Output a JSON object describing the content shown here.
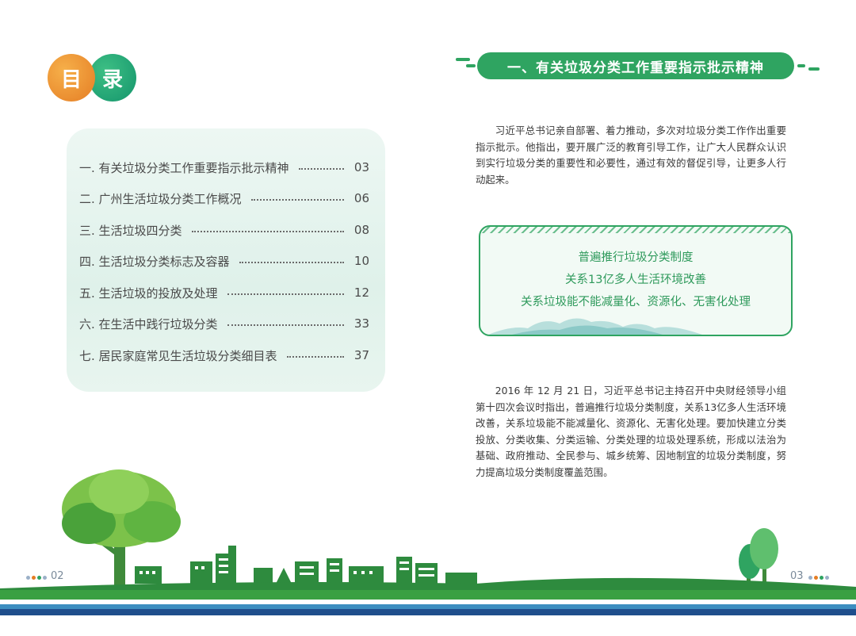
{
  "left_page": {
    "title_chars": [
      "目",
      "录"
    ],
    "toc": [
      {
        "label": "一. 有关垃圾分类工作重要指示批示精神",
        "page": "03"
      },
      {
        "label": "二. 广州生活垃圾分类工作概况",
        "page": "06"
      },
      {
        "label": "三. 生活垃圾四分类",
        "page": "08"
      },
      {
        "label": "四. 生活垃圾分类标志及容器",
        "page": "10"
      },
      {
        "label": "五. 生活垃圾的投放及处理",
        "page": "12"
      },
      {
        "label": "六. 在生活中践行垃圾分类",
        "page": "33"
      },
      {
        "label": "七. 居民家庭常见生活垃圾分类细目表",
        "page": "37"
      }
    ],
    "page_number": "02"
  },
  "right_page": {
    "section_title": "一、有关垃圾分类工作重要指示批示精神",
    "paragraph1": "习近平总书记亲自部署、着力推动，多次对垃圾分类工作作出重要指示批示。他指出，要开展广泛的教育引导工作，让广大人民群众认识到实行垃圾分类的重要性和必要性，通过有效的督促引导，让更多人行动起来。",
    "quote": [
      "普遍推行垃圾分类制度",
      "关系13亿多人生活环境改善",
      "关系垃圾能不能减量化、资源化、无害化处理"
    ],
    "paragraph2": "2016 年 12 月 21 日，习近平总书记主持召开中央财经领导小组第十四次会议时指出，普遍推行垃圾分类制度，关系13亿多人生活环境改善，关系垃圾能不能减量化、资源化、无害化处理。要加快建立分类投放、分类收集、分类运输、分类处理的垃圾处理系统，形成以法治为基础、政府推动、全民参与、城乡统筹、因地制宜的垃圾分类制度，努力提高垃圾分类制度覆盖范围。",
    "page_number": "03"
  },
  "colors": {
    "green": "#2fa461",
    "orange": "#e57d24",
    "navy": "#1f4e8c"
  }
}
